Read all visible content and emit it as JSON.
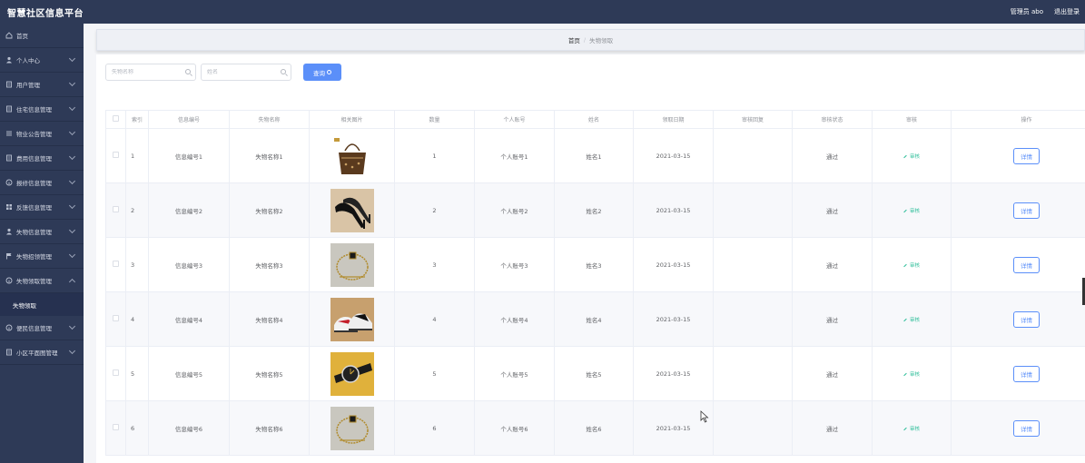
{
  "header": {
    "brand": "智慧社区信息平台",
    "admin": "管理员 abo",
    "logout": "退出登录"
  },
  "sidebar": {
    "items": [
      {
        "label": "首页",
        "icon": "home-icon"
      },
      {
        "label": "个人中心",
        "icon": "user-icon"
      },
      {
        "label": "用户管理",
        "icon": "doc-icon"
      },
      {
        "label": "住宅信息管理",
        "icon": "doc-icon"
      },
      {
        "label": "物业公告管理",
        "icon": "list-icon"
      },
      {
        "label": "费用信息管理",
        "icon": "doc-icon"
      },
      {
        "label": "报修信息管理",
        "icon": "info-icon"
      },
      {
        "label": "反馈信息管理",
        "icon": "grid-icon"
      },
      {
        "label": "失物信息管理",
        "icon": "user-icon"
      },
      {
        "label": "失物招领管理",
        "icon": "flag-icon"
      },
      {
        "label": "失物领取管理",
        "icon": "info-icon",
        "expanded": true,
        "sub": "失物领取"
      },
      {
        "label": "便民信息管理",
        "icon": "info-icon"
      },
      {
        "label": "小区平面图管理",
        "icon": "doc-icon"
      }
    ]
  },
  "breadcrumb": {
    "home": "首页",
    "current": "失物领取"
  },
  "search": {
    "name_placeholder": "失物名称",
    "person_placeholder": "姓名",
    "query_label": "查询"
  },
  "table": {
    "headers": [
      "索引",
      "信息编号",
      "失物名称",
      "相关图片",
      "数量",
      "个人账号",
      "姓名",
      "领取日期",
      "审核回复",
      "审核状态",
      "审核",
      "操作"
    ],
    "audit_label": "审核",
    "detail_label": "详情",
    "rows": [
      {
        "index": "1",
        "code": "信息编号1",
        "name": "失物名称1",
        "image": "handbag",
        "qty": "1",
        "account": "个人账号1",
        "person": "姓名1",
        "date": "2021-03-15",
        "reply": "",
        "status": "通过"
      },
      {
        "index": "2",
        "code": "信息编号2",
        "name": "失物名称2",
        "image": "heels",
        "qty": "2",
        "account": "个人账号2",
        "person": "姓名2",
        "date": "2021-03-15",
        "reply": "",
        "status": "通过"
      },
      {
        "index": "3",
        "code": "信息编号3",
        "name": "失物名称3",
        "image": "necklace",
        "qty": "3",
        "account": "个人账号3",
        "person": "姓名3",
        "date": "2021-03-15",
        "reply": "",
        "status": "通过"
      },
      {
        "index": "4",
        "code": "信息编号4",
        "name": "失物名称4",
        "image": "sneakers",
        "qty": "4",
        "account": "个人账号4",
        "person": "姓名4",
        "date": "2021-03-15",
        "reply": "",
        "status": "通过"
      },
      {
        "index": "5",
        "code": "信息编号5",
        "name": "失物名称5",
        "image": "watch",
        "qty": "5",
        "account": "个人账号5",
        "person": "姓名5",
        "date": "2021-03-15",
        "reply": "",
        "status": "通过"
      },
      {
        "index": "6",
        "code": "信息编号6",
        "name": "失物名称6",
        "image": "necklace",
        "qty": "6",
        "account": "个人账号6",
        "person": "姓名6",
        "date": "2021-03-15",
        "reply": "",
        "status": "通过"
      }
    ]
  },
  "colors": {
    "sidebar_bg": "#2e3a57",
    "accent": "#5b8ff9",
    "audit": "#2fbf9a"
  }
}
